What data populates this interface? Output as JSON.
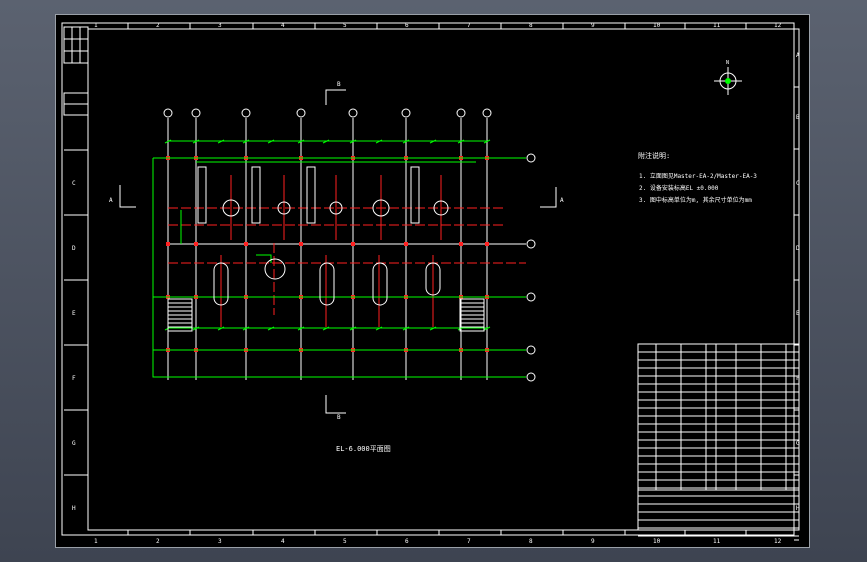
{
  "drawing": {
    "ruler_top": [
      "1",
      "2",
      "3",
      "4",
      "5",
      "6",
      "7",
      "8",
      "9",
      "10",
      "11",
      "12"
    ],
    "ruler_bottom": [
      "1",
      "2",
      "3",
      "4",
      "5",
      "6",
      "7",
      "8",
      "9",
      "10",
      "11",
      "12"
    ],
    "ruler_left": [
      "C",
      "D",
      "E",
      "F",
      "G",
      "H"
    ],
    "ruler_right": [
      "A",
      "B",
      "C",
      "D",
      "E",
      "F",
      "G",
      "H"
    ],
    "section_label_top": "B",
    "section_label_bottom": "B",
    "section_label_left": "A",
    "section_label_right": "A",
    "plan_caption": "EL-6.000平面图",
    "notes_heading": "附注说明:",
    "notes": [
      "1. 立面图见Master-EA-2/Master-EA-3",
      "2. 设备安装标高EL ±0.000",
      "3. 图中标高单位为m, 其余尺寸单位为mm"
    ],
    "compass_label": "N"
  },
  "colors": {
    "frame": "#ffffff",
    "pipe_green": "#00ff00",
    "centerline_red": "#ff2020",
    "dimension_yellow": "#ffff66",
    "background": "#000000"
  }
}
